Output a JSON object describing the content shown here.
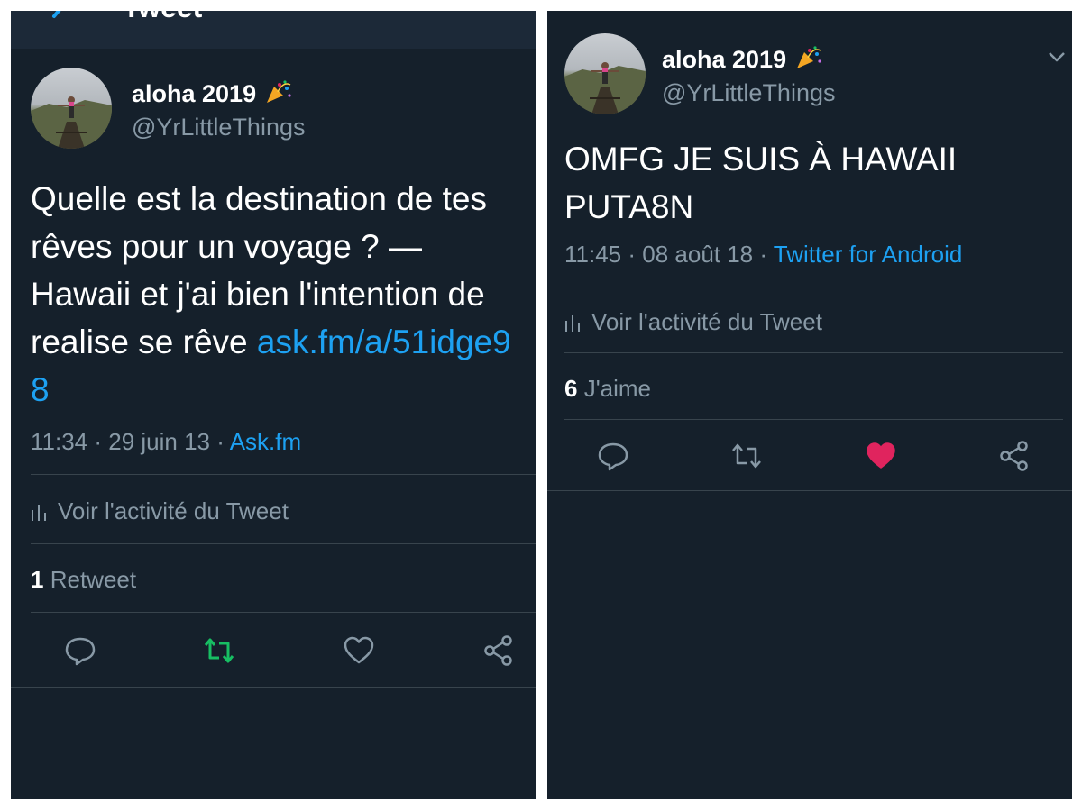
{
  "left": {
    "header": {
      "title": "Tweet",
      "back_icon": "back-arrow-icon"
    },
    "author": {
      "name": "aloha 2019",
      "handle": "@YrLittleThings",
      "emoji": "party-popper-icon"
    },
    "tweet": {
      "text": "Quelle est la destination de tes rêves pour un voyage ? — Hawaii et j'ai bien l'intention de realise se rêve ",
      "link": "ask.fm/a/51idge98"
    },
    "meta": {
      "time": "11:34",
      "date": "29 juin 13",
      "source": "Ask.fm",
      "separator": " · "
    },
    "activity_label": "Voir l'activité du Tweet",
    "stats": {
      "count": "1",
      "label": "Retweet"
    },
    "actions": [
      "reply-icon",
      "retweet-icon",
      "like-icon",
      "share-icon"
    ],
    "colors": {
      "retweet_active": "#17bf63"
    }
  },
  "right": {
    "author": {
      "name": "aloha 2019",
      "handle": "@YrLittleThings",
      "emoji": "party-popper-icon"
    },
    "tweet": {
      "text": "OMFG JE SUIS À HAWAII PUTA8N"
    },
    "meta": {
      "time": "11:45",
      "date": "08 août 18",
      "source": "Twitter for Android",
      "separator": " · "
    },
    "activity_label": "Voir l'activité du Tweet",
    "stats": {
      "count": "6",
      "label": "J'aime"
    },
    "actions": [
      "reply-icon",
      "retweet-icon",
      "like-icon",
      "share-icon"
    ],
    "colors": {
      "like_active": "#e0245e"
    }
  },
  "theme": {
    "background": "#15202b",
    "header": "#1c2938",
    "secondary_text": "#8899a6",
    "link": "#1da1f2",
    "divider": "#38444d"
  }
}
